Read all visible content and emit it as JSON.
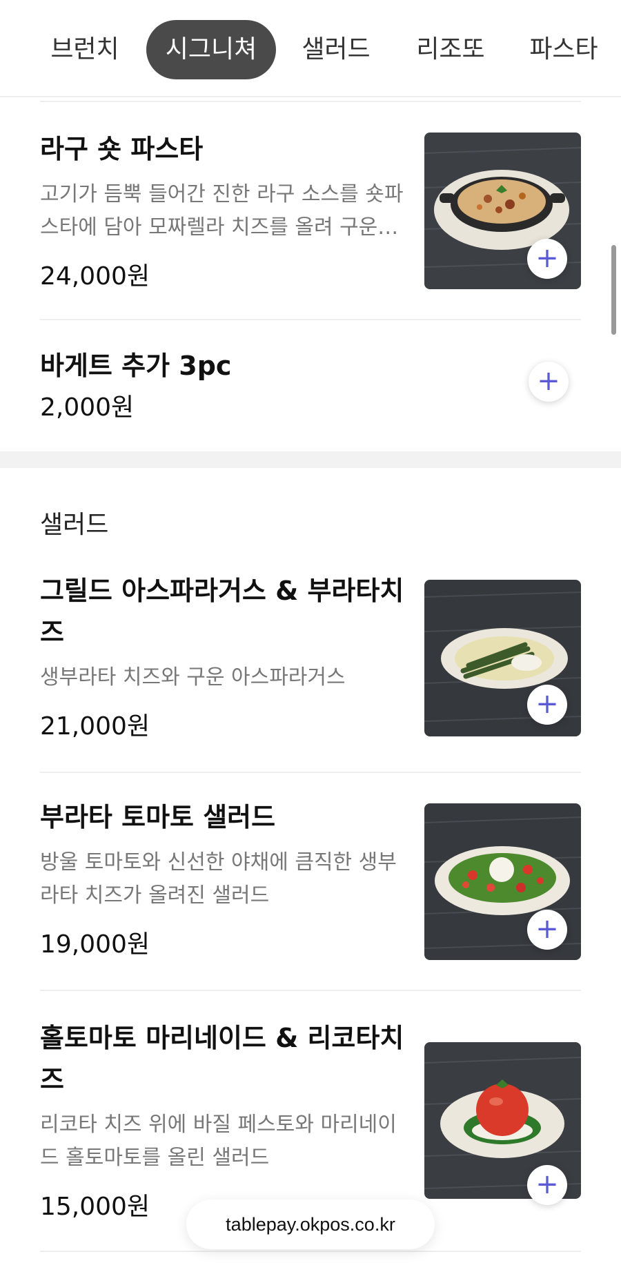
{
  "tabs": [
    {
      "label": "브런치",
      "active": false
    },
    {
      "label": "시그니쳐",
      "active": true
    },
    {
      "label": "샐러드",
      "active": false
    },
    {
      "label": "리조또",
      "active": false
    },
    {
      "label": "파스타",
      "active": false
    }
  ],
  "items": [
    {
      "name": "라구 숏 파스타",
      "desc": "고기가 듬뿍 들어간 진한 라구 소스를 숏파스타에 담아 모짜렐라 치즈를 올려 구운…",
      "price": "24,000원",
      "image": "ragu-pasta-dish"
    },
    {
      "name": "바게트 추가 3pc",
      "price": "2,000원"
    }
  ],
  "salad_section": {
    "title": "샐러드",
    "items": [
      {
        "name": "그릴드 아스파라거스 & 부라타치즈",
        "desc": "생부라타 치즈와 구운 아스파라거스",
        "price": "21,000원",
        "image": "asparagus-burrata-dish"
      },
      {
        "name": "부라타 토마토 샐러드",
        "desc": "방울 토마토와 신선한 야채에 큼직한 생부라타 치즈가 올려진 샐러드",
        "price": "19,000원",
        "image": "burrata-tomato-salad-dish"
      },
      {
        "name": "홀토마토 마리네이드 & 리코타치즈",
        "desc": "리코타 치즈 위에 바질 페스토와 마리네이드 홀토마토를 올린 샐러드",
        "price": "15,000원",
        "image": "whole-tomato-ricotta-dish"
      }
    ]
  },
  "footer": {
    "url": "tablepay.okpos.co.kr"
  },
  "colors": {
    "active_tab": "#4a4a4a",
    "accent_plus": "#5a5ad6",
    "desc_text": "#777777"
  }
}
